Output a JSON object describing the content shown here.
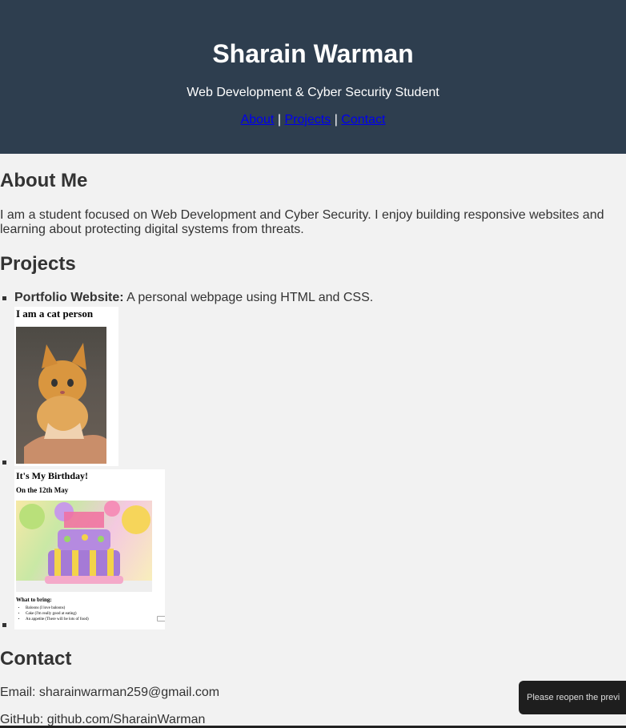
{
  "header": {
    "name": "Sharain Warman",
    "subtitle": "Web Development & Cyber Security Student",
    "nav": [
      {
        "label": "About"
      },
      {
        "label": "Projects"
      },
      {
        "label": "Contact"
      }
    ],
    "separator": "|",
    "background_color": "#2e3e4f",
    "link_color": "#0000ee"
  },
  "about": {
    "heading": "About Me",
    "text": "I am a student focused on Web Development and Cyber Security. I enjoy building responsive websites and learning about protecting digital systems from threats."
  },
  "projects": {
    "heading": "Projects",
    "items": [
      {
        "title": "Portfolio Website:",
        "description": " A personal webpage using HTML and CSS."
      }
    ],
    "cat_thumbnail": {
      "title": "I am a cat person"
    },
    "birthday_thumbnail": {
      "title": "It's My Birthday!",
      "date": "On the 12th May",
      "bring_heading": "What to bring:",
      "bring_items": [
        "Baloons (I love baloons)",
        "Cake (I'm really good at eating)",
        "An appetite (There will be lots of food)"
      ]
    }
  },
  "contact": {
    "heading": "Contact",
    "email": "Email: sharainwarman259@gmail.com",
    "github": "GitHub: github.com/SharainWarman"
  },
  "toast": {
    "text": "Please reopen the previ"
  }
}
